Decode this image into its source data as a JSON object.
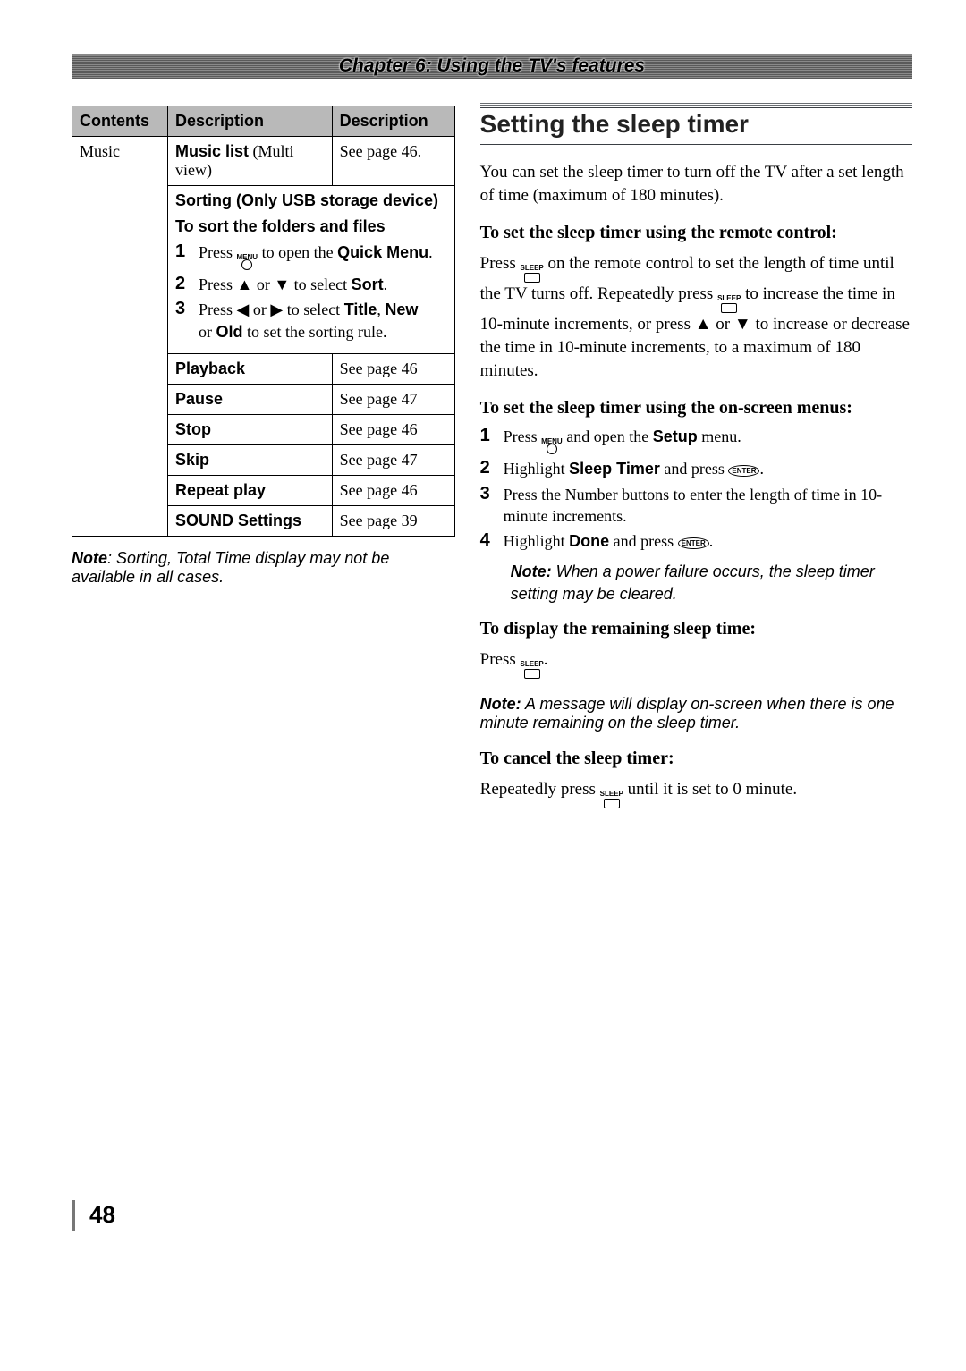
{
  "chapter": "Chapter 6: Using the TV's features",
  "table": {
    "headers": [
      "Contents",
      "Description",
      "Description"
    ],
    "contents_label": "Music",
    "row1_left": "Music list",
    "row1_mid": "(Multi view)",
    "row1_right": "See page 46.",
    "sorting_heading": "Sorting (Only USB storage device)",
    "tosort_heading": "To sort the folders and files",
    "steps": [
      {
        "n": "1",
        "pre": "Press ",
        "icon": "MENU",
        "post": " to open the ",
        "bold": "Quick Menu",
        "tail": "."
      },
      {
        "n": "2",
        "pre": "Press ",
        "arrows": "ud",
        "mid": " to select ",
        "bold": "Sort",
        "tail": "."
      },
      {
        "n": "3",
        "pre": "Press ",
        "arrows": "lr",
        "mid": " to select ",
        "bold": "Title",
        "comma": ", ",
        "bold2": "New",
        "line2_pre": "or ",
        "bold3": "Old",
        "line2_post": " to set the sorting rule."
      }
    ],
    "rows": [
      {
        "label": "Playback",
        "ref": "See page 46"
      },
      {
        "label": "Pause",
        "ref": "See page 47"
      },
      {
        "label": "Stop",
        "ref": "See page 46"
      },
      {
        "label": "Skip",
        "ref": "See page 47"
      },
      {
        "label": "Repeat play",
        "ref": "See page 46"
      },
      {
        "label": "SOUND Settings",
        "ref": "See page 39"
      }
    ]
  },
  "note_left": {
    "label": "Note",
    "text": ": Sorting, Total Time display may not be available in all cases."
  },
  "right": {
    "title": "Setting the sleep timer",
    "intro": "You can set the sleep timer to turn off the TV after a set length of time (maximum of 180 minutes).",
    "h1": "To set the sleep timer using the remote control:",
    "p1_a": "Press ",
    "p1_b": " on the remote control to set the length of time until the TV turns off. Repeatedly press ",
    "p1_c": " to increase the time in 10-minute increments, or press ",
    "p1_d": " to increase or decrease the time in 10-minute increments, to a maximum of 180 minutes.",
    "h2": "To set the sleep timer using the on-screen menus:",
    "step1_a": "Press ",
    "step1_b": " and open the ",
    "step1_bold": "Setup",
    "step1_c": " menu.",
    "step2_a": "Highlight ",
    "step2_bold": "Sleep Timer",
    "step2_b": " and press ",
    "step3": "Press the Number buttons to enter the length of time in 10-minute increments.",
    "step4_a": "Highlight ",
    "step4_bold": "Done",
    "step4_b": " and press ",
    "note1_label": "Note:",
    "note1_text": " When a power failure occurs, the sleep timer setting may be cleared.",
    "h3": "To display the remaining sleep time:",
    "p3_a": "Press ",
    "p3_b": ".",
    "note2_label": "Note:",
    "note2_text": " A message will display on-screen when there is one minute remaining on the sleep timer.",
    "h4": "To cancel the sleep timer:",
    "p4_a": "Repeatedly press ",
    "p4_b": " until it is set to 0 minute."
  },
  "page_number": "48",
  "icons": {
    "menu": "MENU",
    "sleep": "SLEEP",
    "enter": "ENTER"
  }
}
